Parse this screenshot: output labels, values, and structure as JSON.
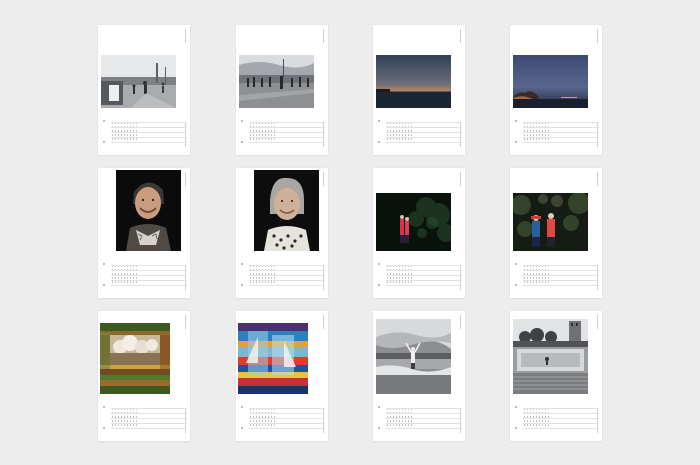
{
  "page": {
    "background": "#eeedee"
  },
  "calendar_pages": [
    {
      "photo": "pier-crowd-bw",
      "orientation": "landscape"
    },
    {
      "photo": "boardwalk-people-bw",
      "orientation": "landscape"
    },
    {
      "photo": "dusk-sea-orange",
      "orientation": "landscape"
    },
    {
      "photo": "night-coast-blue",
      "orientation": "landscape"
    },
    {
      "photo": "smiling-elderly-woman-portrait",
      "orientation": "portrait"
    },
    {
      "photo": "elderly-woman-grey-hair-portrait",
      "orientation": "portrait"
    },
    {
      "photo": "couple-red-jackets-night-forest",
      "orientation": "landscape"
    },
    {
      "photo": "children-red-blue-jackets-forest",
      "orientation": "landscape"
    },
    {
      "photo": "glitch-clouds-art",
      "orientation": "portrait"
    },
    {
      "photo": "glitch-sailboats-art",
      "orientation": "portrait"
    },
    {
      "photo": "person-arms-raised-beach-bw",
      "orientation": "landscape"
    },
    {
      "photo": "rooftop-pool-bw",
      "orientation": "landscape"
    }
  ]
}
